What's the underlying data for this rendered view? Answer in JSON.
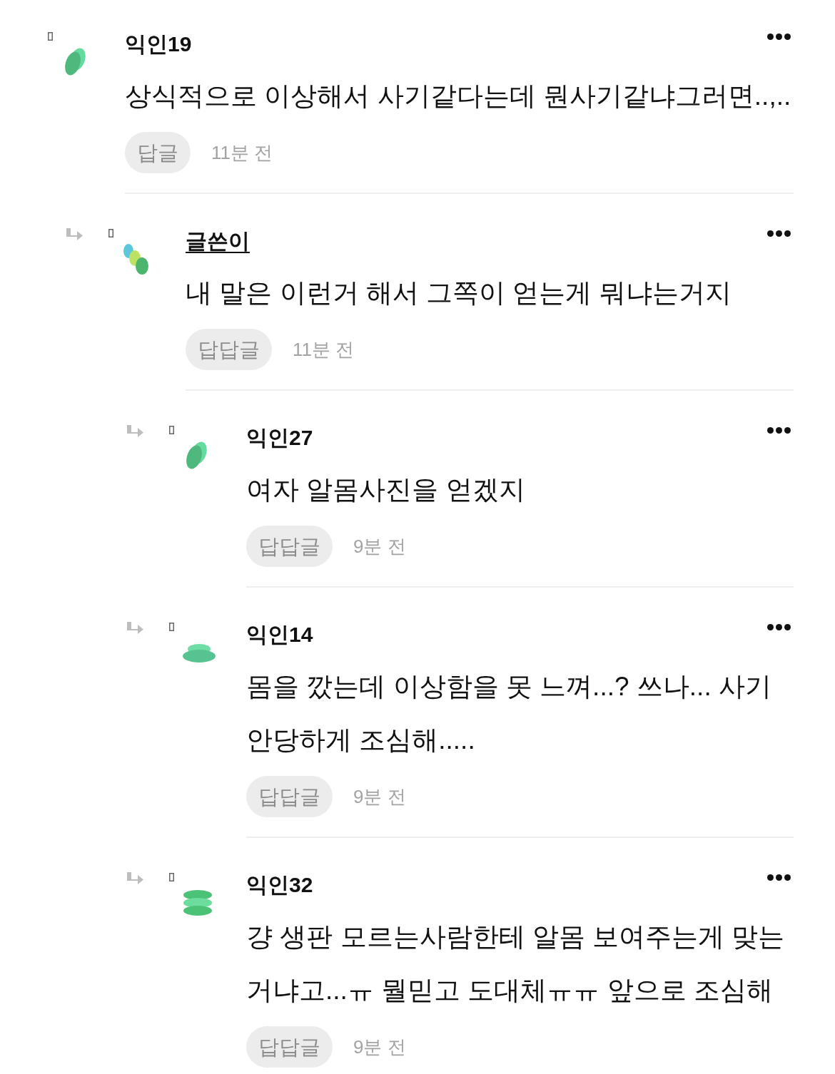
{
  "comments": [
    {
      "author": "익인19",
      "op": false,
      "avatar": {
        "kind": "tilted"
      },
      "text": "상식적으로 이상해서 사기같다는데 뭔사기같냐그러면..,..",
      "reply_label": "답글",
      "time": "11분 전",
      "children": [
        {
          "author": "글쓴이",
          "op": true,
          "avatar": {
            "kind": "cluster"
          },
          "text": "내 말은 이런거 해서 그쪽이 얻는게 뭐냐는거지",
          "reply_label": "답답글",
          "time": "11분 전",
          "children": [
            {
              "author": "익인27",
              "op": false,
              "avatar": {
                "kind": "tilted"
              },
              "text": "여자 알몸사진을 얻겠지",
              "reply_label": "답답글",
              "time": "9분 전"
            },
            {
              "author": "익인14",
              "op": false,
              "avatar": {
                "kind": "pair"
              },
              "text": "몸을 깠는데 이상함을 못 느껴...? 쓰나... 사기 안당하게 조심해.....",
              "reply_label": "답답글",
              "time": "9분 전"
            },
            {
              "author": "익인32",
              "op": false,
              "avatar": {
                "kind": "stack"
              },
              "text": "걍 생판 모르는사람한테 알몸 보여주는게 맞는 거냐고...ㅠ 뭘믿고 도대체ㅠㅠ 앞으로 조심해",
              "reply_label": "답답글",
              "time": "9분 전"
            }
          ]
        }
      ]
    }
  ]
}
